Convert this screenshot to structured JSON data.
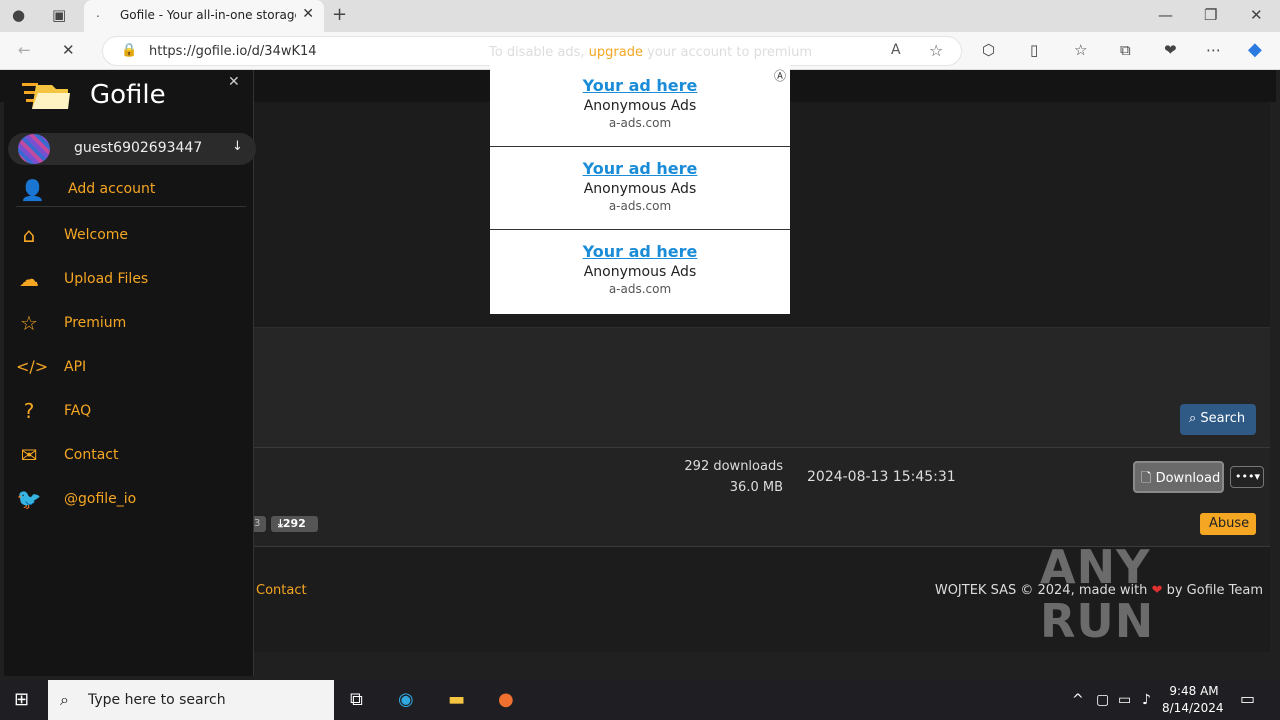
{
  "browser": {
    "tab_title": "Gofile - Your all-in-one storage s",
    "url": "https://gofile.io/d/34wK14"
  },
  "sidebar": {
    "brand": "Gofile",
    "username": "guest6902693447",
    "add_account": "Add account",
    "items": [
      {
        "label": "Welcome",
        "icon": "home-icon"
      },
      {
        "label": "Upload Files",
        "icon": "cloud-upload-icon"
      },
      {
        "label": "Premium",
        "icon": "star-icon"
      },
      {
        "label": "API",
        "icon": "code-icon"
      },
      {
        "label": "FAQ",
        "icon": "question-icon"
      },
      {
        "label": "Contact",
        "icon": "envelope-icon"
      },
      {
        "label": "@gofile_io",
        "icon": "twitter-icon"
      }
    ]
  },
  "ads": {
    "note_before": "To disable ads, ",
    "note_link": "upgrade",
    "note_after": " your account to premium",
    "cells": [
      {
        "title": "Your ad here",
        "sub": "Anonymous Ads",
        "domain": "a-ads.com"
      },
      {
        "title": "Your ad here",
        "sub": "Anonymous Ads",
        "domain": "a-ads.com"
      },
      {
        "title": "Your ad here",
        "sub": "Anonymous Ads",
        "domain": "a-ads.com"
      }
    ]
  },
  "file": {
    "search_label": "Search",
    "downloads": "292 downloads",
    "size": "36.0 MB",
    "date": "2024-08-13 15:45:31",
    "download_label": "Download",
    "abuse_label": "Abuse",
    "badge_partial": "3",
    "badge_downloads": "292"
  },
  "footer": {
    "contact": "Contact",
    "copy_before": "WOJTEK SAS © 2024, made with ",
    "copy_after": " by Gofile Team"
  },
  "watermark": "ANY RUN",
  "taskbar": {
    "search_placeholder": "Type here to search",
    "time": "9:48 AM",
    "date": "8/14/2024"
  },
  "colors": {
    "accent": "#f5a623",
    "search_button": "#2f5a86"
  }
}
